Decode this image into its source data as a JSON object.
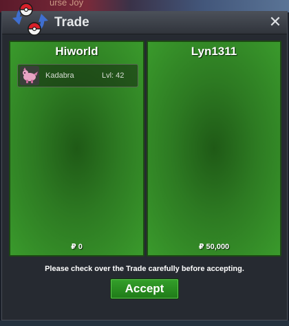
{
  "background": {
    "text": "urse Joy"
  },
  "window": {
    "title": "Trade",
    "close_symbol": "✕",
    "logo_icon": "pokeball-logo-icon"
  },
  "left_panel": {
    "player": "Hiworld",
    "items": [
      {
        "icon": "kadabra-sprite-icon",
        "name": "Kadabra",
        "level": "Lvl: 42"
      }
    ],
    "money_symbol": "₽",
    "money": "0"
  },
  "right_panel": {
    "player": "Lyn1311",
    "items": [],
    "money_symbol": "₽",
    "money": "50,000"
  },
  "notice": "Please check over the Trade carefully before accepting.",
  "accept_label": "Accept",
  "colors": {
    "panel_green": "#2d7a22",
    "accept_green": "#2a9020",
    "window_bg": "#262a31"
  }
}
